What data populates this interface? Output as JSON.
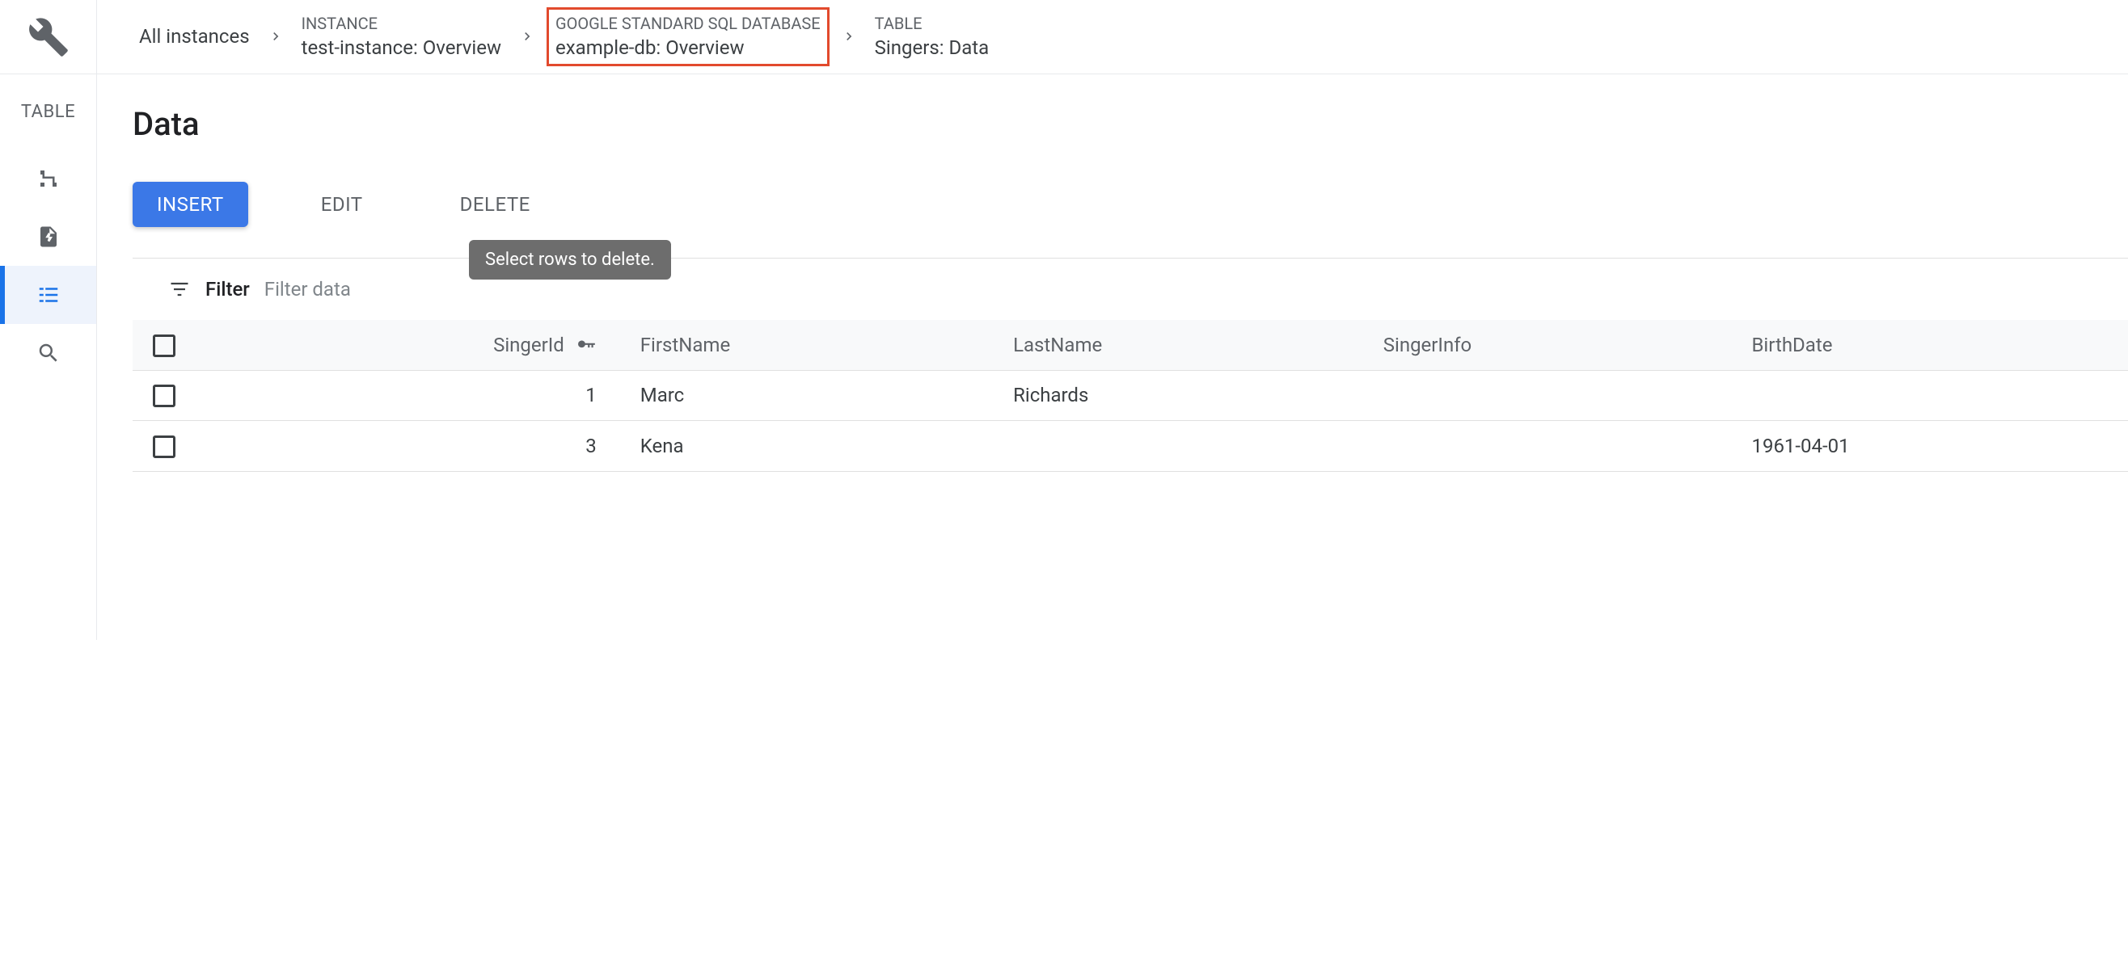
{
  "breadcrumbs": {
    "root": "All instances",
    "instance": {
      "label": "INSTANCE",
      "value": "test-instance: Overview"
    },
    "database": {
      "label": "GOOGLE STANDARD SQL DATABASE",
      "value": "example-db: Overview"
    },
    "table": {
      "label": "TABLE",
      "value": "Singers: Data"
    }
  },
  "sidebar": {
    "title": "TABLE"
  },
  "page": {
    "title": "Data"
  },
  "actions": {
    "insert": "INSERT",
    "edit": "EDIT",
    "delete": "DELETE",
    "delete_tooltip": "Select rows to delete."
  },
  "filter": {
    "label": "Filter",
    "placeholder": "Filter data"
  },
  "table": {
    "headers": [
      "SingerId",
      "FirstName",
      "LastName",
      "SingerInfo",
      "BirthDate"
    ],
    "rows": [
      {
        "SingerId": "1",
        "FirstName": "Marc",
        "LastName": "Richards",
        "SingerInfo": "",
        "BirthDate": ""
      },
      {
        "SingerId": "3",
        "FirstName": "Kena",
        "LastName": "",
        "SingerInfo": "",
        "BirthDate": "1961-04-01"
      }
    ]
  }
}
